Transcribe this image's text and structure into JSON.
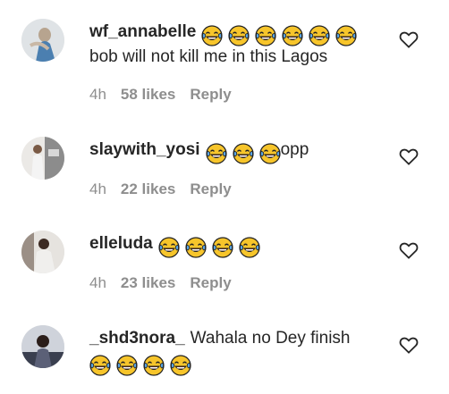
{
  "comments": [
    {
      "username": "wf_annabelle",
      "emoji_count": 6,
      "emoji": "face-with-tears-of-joy",
      "text": "",
      "text_line2": "bob will not kill me in this Lagos",
      "time": "4h",
      "likes": "58 likes",
      "reply": "Reply"
    },
    {
      "username": "slaywith_yosi",
      "emoji_count": 3,
      "emoji": "face-with-tears-of-joy",
      "text": "opp",
      "time": "4h",
      "likes": "22 likes",
      "reply": "Reply"
    },
    {
      "username": "elleluda",
      "emoji_count": 4,
      "emoji": "face-with-tears-of-joy",
      "text": "",
      "time": "4h",
      "likes": "23 likes",
      "reply": "Reply"
    },
    {
      "username": "_shd3nora_",
      "emoji_count": 4,
      "emoji": "face-with-tears-of-joy",
      "text": "Wahala no Dey finish",
      "time": "",
      "likes": "",
      "reply": ""
    }
  ],
  "colors": {
    "username": "#262626",
    "meta": "#8e8e8e",
    "emoji_face": "#f7c52b",
    "emoji_tear": "#5aa7e6"
  }
}
